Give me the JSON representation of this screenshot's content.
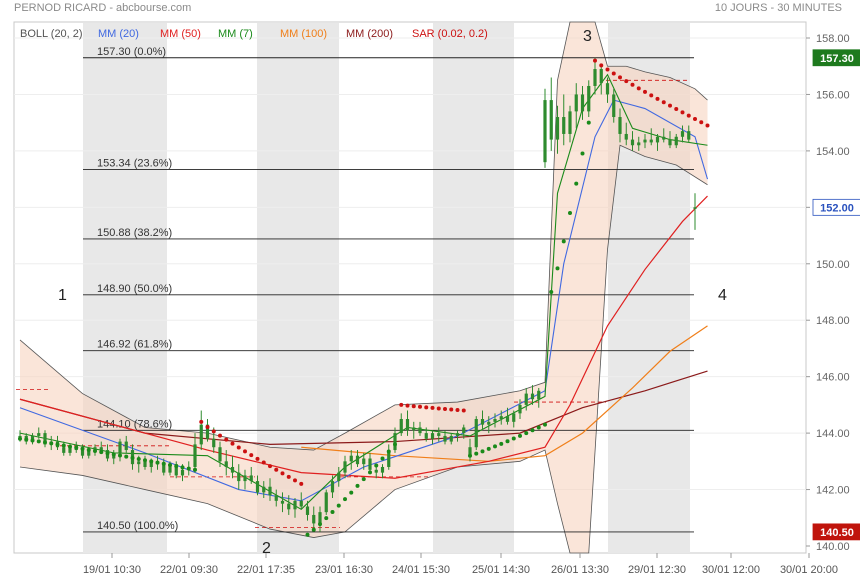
{
  "header": {
    "title": "PERNOD RICARD - abcbourse.com",
    "period": "10 JOURS - 30 MINUTES"
  },
  "colors": {
    "mm20": "#4169e1",
    "mm50": "#e02020",
    "mm7": "#1a8a1a",
    "mm100": "#f07f1a",
    "mm200": "#8b1a1a",
    "sar_up": "#1a8a1a",
    "sar_down": "#cc1111",
    "candle_up": "#2e8b2e",
    "candle_down": "#2e8b2e",
    "boll_fill": "#f6d3c0",
    "session_shade": "#e8e8e8",
    "last_price_badge": "#1e7a1e",
    "low_badge": "#c0140c"
  },
  "chart_data": {
    "type": "candlestick",
    "legend": [
      {
        "label": "BOLL (20, 2)",
        "color": "#555555"
      },
      {
        "label": "MM (20)",
        "color": "#4169e1"
      },
      {
        "label": "MM (50)",
        "color": "#e02020"
      },
      {
        "label": "MM (7)",
        "color": "#1a8a1a"
      },
      {
        "label": "MM (100)",
        "color": "#f07f1a"
      },
      {
        "label": "MM (200)",
        "color": "#8b1a1a"
      },
      {
        "label": "SAR (0.02, 0.2)",
        "color": "#cc1111"
      }
    ],
    "ylim": [
      140,
      158
    ],
    "y_ticks": [
      {
        "value": 142,
        "label": "142.00"
      },
      {
        "value": 144,
        "label": "144.00"
      },
      {
        "value": 146,
        "label": "146.00"
      },
      {
        "value": 148,
        "label": "148.00"
      },
      {
        "value": 150,
        "label": "150.00"
      },
      {
        "value": 152,
        "label": "152.00"
      },
      {
        "value": 154,
        "label": "154.00"
      },
      {
        "value": 156,
        "label": "156.00"
      },
      {
        "value": 158,
        "label": "158.00"
      },
      {
        "value": 140,
        "label": "140.00"
      }
    ],
    "x_ticks": [
      "19/01 10:30",
      "22/01 09:30",
      "22/01 17:35",
      "23/01 16:30",
      "24/01 15:30",
      "25/01 14:30",
      "26/01 13:30",
      "29/01 12:30",
      "30/01 12:00",
      "30/01 20:00"
    ],
    "fibonacci": [
      {
        "label": "157.30  (0.0%)",
        "value": 157.3
      },
      {
        "label": "153.34  (23.6%)",
        "value": 153.34
      },
      {
        "label": "150.88  (38.2%)",
        "value": 150.88
      },
      {
        "label": "148.90  (50.0%)",
        "value": 148.9
      },
      {
        "label": "146.92  (61.8%)",
        "value": 146.92
      },
      {
        "label": "144.10  (78.6%)",
        "value": 144.1
      },
      {
        "label": "140.50  (100.0%)",
        "value": 140.5
      }
    ],
    "wave_labels": [
      "1",
      "2",
      "3",
      "4"
    ],
    "badges": [
      {
        "label": "157.30",
        "value": 157.3,
        "kind": "high"
      },
      {
        "label": "152.00",
        "value": 152.0,
        "kind": "last"
      },
      {
        "label": "140.50",
        "value": 140.5,
        "kind": "low"
      }
    ],
    "candles": [
      [
        143.9,
        144.1,
        143.7,
        143.9
      ],
      [
        143.9,
        144.0,
        143.6,
        143.7
      ],
      [
        143.7,
        144.0,
        143.6,
        143.9
      ],
      [
        143.9,
        144.2,
        143.8,
        144.0
      ],
      [
        144.0,
        144.1,
        143.5,
        143.6
      ],
      [
        143.6,
        143.9,
        143.4,
        143.7
      ],
      [
        143.7,
        143.9,
        143.4,
        143.5
      ],
      [
        143.5,
        143.7,
        143.2,
        143.3
      ],
      [
        143.3,
        143.6,
        143.2,
        143.5
      ],
      [
        143.5,
        143.7,
        143.3,
        143.4
      ],
      [
        143.4,
        143.6,
        143.1,
        143.2
      ],
      [
        143.2,
        143.5,
        143.1,
        143.4
      ],
      [
        143.4,
        143.6,
        143.2,
        143.5
      ],
      [
        143.5,
        143.7,
        143.3,
        143.4
      ],
      [
        143.4,
        143.6,
        143.0,
        143.1
      ],
      [
        143.1,
        143.4,
        142.9,
        143.3
      ],
      [
        143.3,
        143.8,
        143.0,
        143.7
      ],
      [
        143.7,
        143.9,
        143.3,
        143.4
      ],
      [
        143.4,
        143.6,
        142.7,
        142.9
      ],
      [
        142.9,
        143.2,
        142.6,
        143.0
      ],
      [
        143.0,
        143.2,
        142.7,
        142.8
      ],
      [
        142.8,
        143.1,
        142.6,
        143.0
      ],
      [
        143.0,
        143.2,
        142.7,
        142.9
      ],
      [
        142.9,
        143.1,
        142.5,
        142.6
      ],
      [
        142.6,
        143.0,
        142.5,
        142.9
      ],
      [
        142.9,
        143.0,
        142.4,
        142.5
      ],
      [
        142.5,
        142.9,
        142.3,
        142.7
      ],
      [
        142.7,
        143.0,
        142.5,
        142.8
      ],
      [
        142.8,
        144.0,
        142.6,
        143.6
      ],
      [
        143.6,
        144.8,
        143.4,
        144.3
      ],
      [
        144.3,
        144.5,
        143.7,
        143.8
      ],
      [
        143.8,
        144.2,
        143.3,
        143.5
      ],
      [
        143.5,
        143.7,
        142.8,
        143.0
      ],
      [
        143.0,
        143.4,
        142.5,
        142.8
      ],
      [
        142.8,
        143.2,
        142.4,
        142.6
      ],
      [
        142.6,
        142.9,
        142.0,
        142.3
      ],
      [
        142.3,
        142.7,
        142.0,
        142.5
      ],
      [
        142.5,
        142.8,
        142.2,
        142.3
      ],
      [
        142.3,
        142.5,
        141.8,
        141.9
      ],
      [
        141.9,
        142.3,
        141.7,
        142.1
      ],
      [
        142.1,
        142.4,
        141.6,
        141.8
      ],
      [
        141.8,
        142.0,
        141.4,
        141.6
      ],
      [
        141.6,
        141.9,
        141.2,
        141.5
      ],
      [
        141.5,
        141.8,
        141.1,
        141.3
      ],
      [
        141.3,
        141.7,
        141.0,
        141.6
      ],
      [
        141.6,
        141.9,
        141.3,
        141.4
      ],
      [
        141.4,
        141.6,
        140.9,
        141.1
      ],
      [
        141.1,
        141.4,
        140.6,
        140.8
      ],
      [
        140.8,
        141.4,
        140.5,
        141.2
      ],
      [
        141.2,
        142.0,
        141.1,
        141.9
      ],
      [
        141.9,
        142.5,
        141.7,
        142.3
      ],
      [
        142.3,
        142.8,
        142.1,
        142.6
      ],
      [
        142.6,
        143.2,
        142.4,
        143.0
      ],
      [
        143.0,
        143.4,
        142.7,
        143.2
      ],
      [
        143.2,
        143.4,
        142.8,
        142.9
      ],
      [
        142.9,
        143.3,
        142.7,
        143.1
      ],
      [
        143.1,
        143.3,
        142.6,
        142.7
      ],
      [
        142.7,
        142.9,
        142.4,
        142.6
      ],
      [
        142.6,
        142.9,
        142.4,
        142.8
      ],
      [
        142.8,
        143.6,
        142.7,
        143.4
      ],
      [
        143.4,
        144.2,
        143.3,
        144.0
      ],
      [
        144.0,
        144.7,
        143.9,
        144.5
      ],
      [
        144.5,
        144.8,
        143.9,
        144.1
      ],
      [
        144.1,
        144.4,
        143.8,
        144.2
      ],
      [
        144.2,
        144.4,
        143.9,
        144.0
      ],
      [
        144.0,
        144.2,
        143.7,
        143.8
      ],
      [
        143.8,
        144.1,
        143.6,
        144.0
      ],
      [
        144.0,
        144.2,
        143.7,
        143.9
      ],
      [
        143.9,
        144.1,
        143.6,
        143.7
      ],
      [
        143.7,
        144.0,
        143.6,
        143.9
      ],
      [
        143.9,
        144.1,
        143.7,
        144.0
      ],
      [
        144.0,
        144.3,
        143.8,
        144.2
      ],
      [
        143.2,
        143.8,
        143.0,
        143.5
      ],
      [
        143.5,
        144.6,
        143.4,
        144.5
      ],
      [
        144.5,
        144.8,
        144.1,
        144.3
      ],
      [
        144.3,
        144.6,
        144.0,
        144.4
      ],
      [
        144.4,
        144.7,
        144.2,
        144.5
      ],
      [
        144.5,
        144.8,
        144.3,
        144.6
      ],
      [
        144.6,
        144.9,
        144.3,
        144.4
      ],
      [
        144.4,
        144.8,
        144.2,
        144.7
      ],
      [
        144.7,
        145.2,
        144.5,
        145.0
      ],
      [
        145.0,
        145.6,
        144.8,
        145.4
      ],
      [
        145.4,
        145.7,
        145.0,
        145.2
      ],
      [
        145.2,
        145.6,
        144.9,
        145.5
      ],
      [
        153.6,
        156.2,
        153.4,
        155.8
      ],
      [
        155.8,
        156.6,
        154.0,
        154.4
      ],
      [
        154.4,
        155.6,
        153.9,
        155.2
      ],
      [
        155.2,
        156.0,
        154.2,
        154.6
      ],
      [
        154.6,
        155.6,
        154.3,
        155.4
      ],
      [
        155.4,
        156.4,
        154.8,
        156.0
      ],
      [
        156.0,
        156.3,
        155.1,
        155.4
      ],
      [
        155.4,
        156.5,
        155.2,
        156.3
      ],
      [
        156.3,
        157.3,
        156.0,
        156.9
      ],
      [
        156.9,
        157.0,
        156.0,
        156.4
      ],
      [
        156.4,
        156.6,
        155.7,
        156.0
      ],
      [
        156.0,
        156.2,
        155.0,
        155.2
      ],
      [
        155.2,
        155.5,
        154.3,
        154.6
      ],
      [
        154.6,
        155.0,
        154.2,
        154.4
      ],
      [
        154.4,
        154.7,
        154.0,
        154.2
      ],
      [
        154.2,
        154.5,
        154.0,
        154.3
      ],
      [
        154.3,
        154.6,
        154.1,
        154.4
      ],
      [
        154.4,
        154.8,
        154.2,
        154.3
      ],
      [
        154.3,
        154.6,
        154.0,
        154.5
      ],
      [
        154.5,
        154.8,
        154.3,
        154.4
      ],
      [
        154.4,
        154.7,
        154.1,
        154.2
      ],
      [
        154.2,
        154.6,
        154.1,
        154.5
      ],
      [
        154.5,
        154.9,
        154.3,
        154.7
      ],
      [
        154.7,
        154.9,
        154.3,
        154.4
      ],
      [
        152.0,
        152.5,
        151.2,
        152.0
      ]
    ],
    "sar_down": [
      {
        "range": [
          29,
          45
        ],
        "start": 144.4,
        "end": 142.2
      },
      {
        "range": [
          61,
          71
        ],
        "start": 145.0,
        "end": 144.8
      },
      {
        "range": [
          92,
          110
        ],
        "start": 157.2,
        "end": 154.9
      }
    ],
    "sar_up": [
      {
        "range": [
          0,
          28
        ],
        "start": 143.8,
        "end": 142.7
      },
      {
        "range": [
          46,
          60
        ],
        "start": 140.4,
        "end": 143.6
      },
      {
        "range": [
          72,
          84
        ],
        "start": 143.2,
        "end": 144.3
      },
      {
        "range": [
          85,
          91
        ],
        "start": 149.0,
        "end": 155.0
      }
    ],
    "mm20": [
      [
        0,
        144.9
      ],
      [
        20,
        143.3
      ],
      [
        35,
        142.0
      ],
      [
        45,
        141.6
      ],
      [
        55,
        142.8
      ],
      [
        70,
        143.9
      ],
      [
        84,
        145.5
      ],
      [
        87,
        150.0
      ],
      [
        92,
        154.5
      ],
      [
        95,
        155.8
      ],
      [
        100,
        155.5
      ],
      [
        108,
        154.5
      ],
      [
        110,
        153.0
      ]
    ],
    "mm7": [
      [
        0,
        144.0
      ],
      [
        15,
        143.3
      ],
      [
        30,
        143.2
      ],
      [
        45,
        141.3
      ],
      [
        52,
        142.8
      ],
      [
        62,
        144.2
      ],
      [
        72,
        143.9
      ],
      [
        84,
        145.3
      ],
      [
        86,
        152.5
      ],
      [
        90,
        155.5
      ],
      [
        94,
        156.7
      ],
      [
        98,
        154.8
      ],
      [
        104,
        154.4
      ],
      [
        110,
        154.2
      ]
    ],
    "mm50": [
      [
        0,
        145.2
      ],
      [
        15,
        144.3
      ],
      [
        30,
        143.4
      ],
      [
        45,
        142.6
      ],
      [
        60,
        142.4
      ],
      [
        75,
        143.0
      ],
      [
        84,
        143.5
      ],
      [
        88,
        145.0
      ],
      [
        94,
        147.8
      ],
      [
        100,
        149.8
      ],
      [
        106,
        151.5
      ],
      [
        110,
        152.4
      ]
    ],
    "mm100": [
      [
        45,
        143.5
      ],
      [
        60,
        143.2
      ],
      [
        75,
        143.0
      ],
      [
        84,
        143.2
      ],
      [
        90,
        144.0
      ],
      [
        98,
        145.6
      ],
      [
        104,
        146.9
      ],
      [
        110,
        147.8
      ]
    ],
    "mm200": [
      [
        0,
        145.2
      ],
      [
        20,
        144.0
      ],
      [
        40,
        143.6
      ],
      [
        60,
        143.7
      ],
      [
        80,
        144.0
      ],
      [
        90,
        144.9
      ],
      [
        100,
        145.5
      ],
      [
        110,
        146.2
      ]
    ],
    "boll_upper": [
      [
        0,
        147.3
      ],
      [
        10,
        145.4
      ],
      [
        20,
        144.2
      ],
      [
        30,
        144.0
      ],
      [
        40,
        143.5
      ],
      [
        47,
        143.4
      ],
      [
        52,
        144.0
      ],
      [
        60,
        145.0
      ],
      [
        70,
        145.1
      ],
      [
        80,
        145.5
      ],
      [
        84,
        145.8
      ],
      [
        86,
        156.5
      ],
      [
        88,
        161.0
      ],
      [
        92,
        161.0
      ],
      [
        94,
        157.0
      ],
      [
        97,
        157.0
      ],
      [
        100,
        156.8
      ],
      [
        104,
        156.6
      ],
      [
        108,
        156.2
      ],
      [
        110,
        155.8
      ]
    ],
    "boll_lower": [
      [
        0,
        142.8
      ],
      [
        10,
        142.5
      ],
      [
        20,
        142.0
      ],
      [
        30,
        141.5
      ],
      [
        40,
        140.6
      ],
      [
        47,
        140.3
      ],
      [
        52,
        140.5
      ],
      [
        60,
        142.0
      ],
      [
        70,
        142.8
      ],
      [
        80,
        143.0
      ],
      [
        84,
        143.4
      ],
      [
        86,
        141.5
      ],
      [
        88,
        139.0
      ],
      [
        91,
        139.0
      ],
      [
        94,
        150.5
      ],
      [
        96,
        154.2
      ],
      [
        100,
        153.8
      ],
      [
        105,
        153.5
      ],
      [
        110,
        152.8
      ]
    ]
  }
}
